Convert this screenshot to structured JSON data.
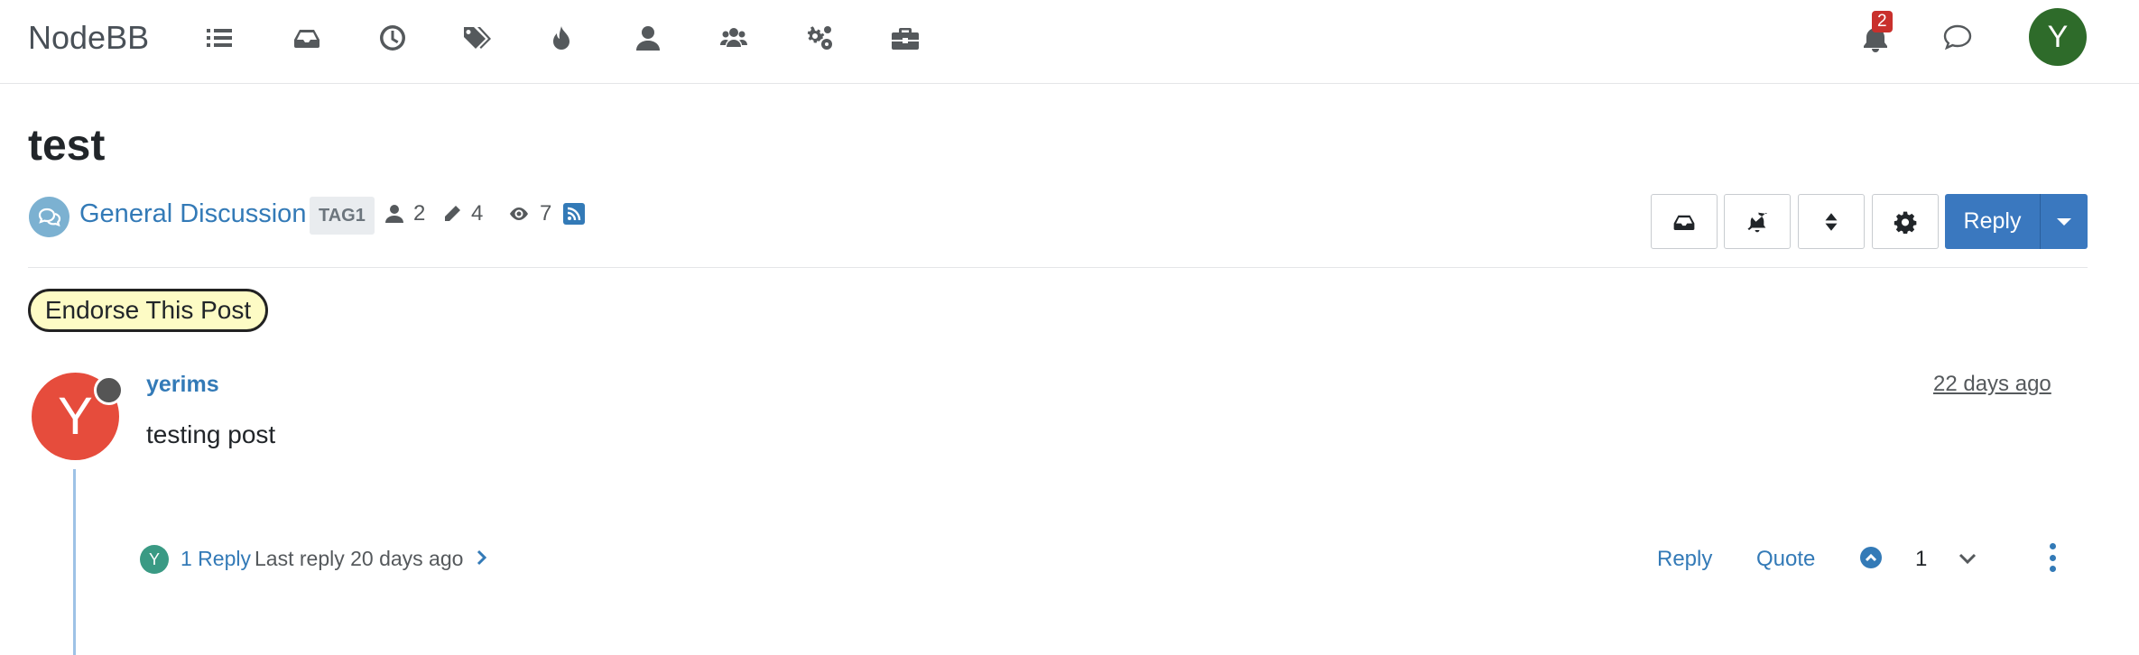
{
  "app": {
    "brand": "NodeBB",
    "nav_icons": [
      "list-icon",
      "inbox-icon",
      "clock-icon",
      "tags-icon",
      "fire-icon",
      "user-icon",
      "users-icon",
      "cogs-icon",
      "briefcase-icon"
    ],
    "notifications_count": "2",
    "user_initial": "Y"
  },
  "topic": {
    "title": "test",
    "category": "General Discussion",
    "tag": "TAG1",
    "stats": {
      "posters": "2",
      "posts": "4",
      "views": "7"
    },
    "reply_label": "Reply"
  },
  "endorse_label": "Endorse This Post",
  "post": {
    "author_initial": "Y",
    "author": "yerims",
    "timestamp": "22 days ago",
    "content": "testing post",
    "reply_avatar_initial": "Y",
    "replies_link": "1 Reply",
    "last_reply": "Last reply 20 days ago",
    "actions": {
      "reply": "Reply",
      "quote": "Quote"
    },
    "votes": "1"
  },
  "colors": {
    "link": "#337ab7",
    "primary_button": "#3a78bf",
    "user_avatar": "#2e6b2a",
    "post_avatar": "#e64c3c",
    "badge": "#c9302c",
    "endorse_bg": "#fdfbc5"
  }
}
